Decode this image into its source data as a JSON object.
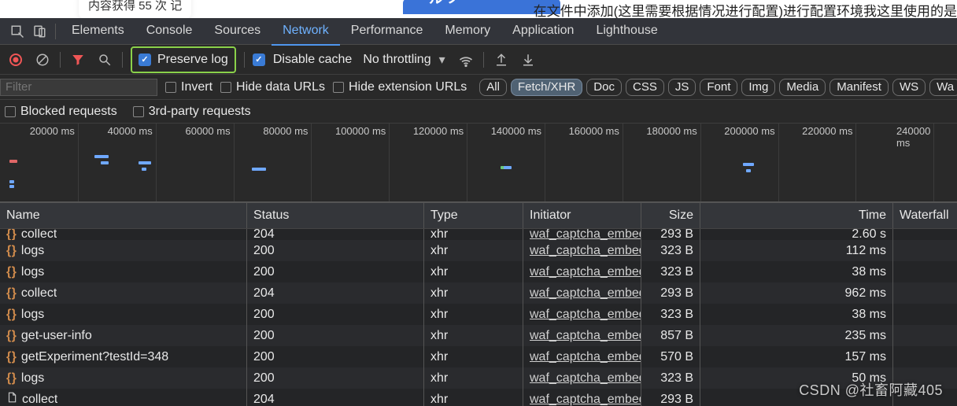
{
  "topstrip": {
    "left_card": "内容获得 55 次 记",
    "right_text": "在文件中添加(这里需要根据情况进行配置)进行配置环境我这里使用的是",
    "blue": "一 ル ノー ー"
  },
  "tabs": {
    "elements": "Elements",
    "console": "Console",
    "sources": "Sources",
    "network": "Network",
    "performance": "Performance",
    "memory": "Memory",
    "application": "Application",
    "lighthouse": "Lighthouse"
  },
  "toolbar": {
    "preserve_log": "Preserve log",
    "disable_cache": "Disable cache",
    "throttling": "No throttling"
  },
  "filter": {
    "placeholder": "Filter",
    "invert": "Invert",
    "hide_data": "Hide data URLs",
    "hide_ext": "Hide extension URLs",
    "pills": [
      "All",
      "Fetch/XHR",
      "Doc",
      "CSS",
      "JS",
      "Font",
      "Img",
      "Media",
      "Manifest",
      "WS",
      "Wa"
    ],
    "active_pill": 1,
    "blocked": "Blocked requests",
    "thirdparty": "3rd-party requests"
  },
  "timeline": {
    "ticks": [
      "20000 ms",
      "40000 ms",
      "60000 ms",
      "80000 ms",
      "100000 ms",
      "120000 ms",
      "140000 ms",
      "160000 ms",
      "180000 ms",
      "200000 ms",
      "220000 ms",
      "240000 ms"
    ]
  },
  "columns": {
    "name": "Name",
    "status": "Status",
    "type": "Type",
    "initiator": "Initiator",
    "size": "Size",
    "time": "Time",
    "waterfall": "Waterfall"
  },
  "rows": [
    {
      "icon": "xhr",
      "name": "collect",
      "status": "204",
      "type": "xhr",
      "initiator": "waf_captcha_embed",
      "size": "293 B",
      "time": "2.60 s",
      "cut": true
    },
    {
      "icon": "xhr",
      "name": "logs",
      "status": "200",
      "type": "xhr",
      "initiator": "waf_captcha_embed",
      "size": "323 B",
      "time": "112 ms"
    },
    {
      "icon": "xhr",
      "name": "logs",
      "status": "200",
      "type": "xhr",
      "initiator": "waf_captcha_embed",
      "size": "323 B",
      "time": "38 ms"
    },
    {
      "icon": "xhr",
      "name": "collect",
      "status": "204",
      "type": "xhr",
      "initiator": "waf_captcha_embed",
      "size": "293 B",
      "time": "962 ms"
    },
    {
      "icon": "xhr",
      "name": "logs",
      "status": "200",
      "type": "xhr",
      "initiator": "waf_captcha_embed",
      "size": "323 B",
      "time": "38 ms"
    },
    {
      "icon": "xhr",
      "name": "get-user-info",
      "status": "200",
      "type": "xhr",
      "initiator": "waf_captcha_embed",
      "size": "857 B",
      "time": "235 ms"
    },
    {
      "icon": "xhr",
      "name": "getExperiment?testId=348",
      "status": "200",
      "type": "xhr",
      "initiator": "waf_captcha_embed",
      "size": "570 B",
      "time": "157 ms"
    },
    {
      "icon": "xhr",
      "name": "logs",
      "status": "200",
      "type": "xhr",
      "initiator": "waf_captcha_embed",
      "size": "323 B",
      "time": "50 ms"
    },
    {
      "icon": "doc",
      "name": "collect",
      "status": "204",
      "type": "xhr",
      "initiator": "waf_captcha_embed",
      "size": "293 B",
      "time": ""
    }
  ],
  "watermark": "CSDN @社畜阿藏405"
}
